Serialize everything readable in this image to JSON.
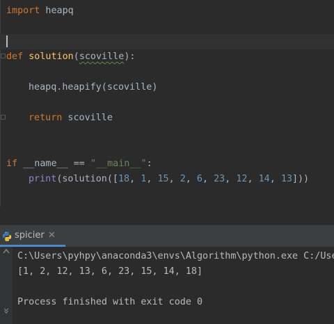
{
  "editor": {
    "lines": [
      {
        "kw": "import",
        "rest": " heapq"
      },
      {
        "kw": "def",
        "fn": "solution",
        "param": "scoville",
        "tail": "):"
      },
      {
        "call": "heapq.heapify(scoville)"
      },
      {
        "kw": "return",
        "rest": " scoville"
      },
      {
        "kw": "if",
        "dunder": " __name__ == ",
        "str": "\"__main__\"",
        "tail": ":"
      },
      {
        "builtin": "print",
        "pre": "(solution([",
        "nums": [
          "18",
          "1",
          "15",
          "2",
          "6",
          "23",
          "12",
          "14",
          "13"
        ],
        "post": "]))"
      }
    ]
  },
  "run_panel": {
    "tab_label": "spicier",
    "close_glyph": "✕",
    "console_lines": [
      "C:\\Users\\pyhpy\\anaconda3\\envs\\Algorithm\\python.exe C:/Use",
      "[1, 2, 12, 13, 6, 23, 15, 14, 18]",
      "",
      "Process finished with exit code 0"
    ]
  },
  "colors": {
    "keyword": "#cc7832",
    "function": "#ffc66d",
    "number": "#6897bb",
    "string": "#6a8759",
    "builtin": "#8888c6",
    "text": "#a9b7c6",
    "accent": "#4a88c7"
  }
}
